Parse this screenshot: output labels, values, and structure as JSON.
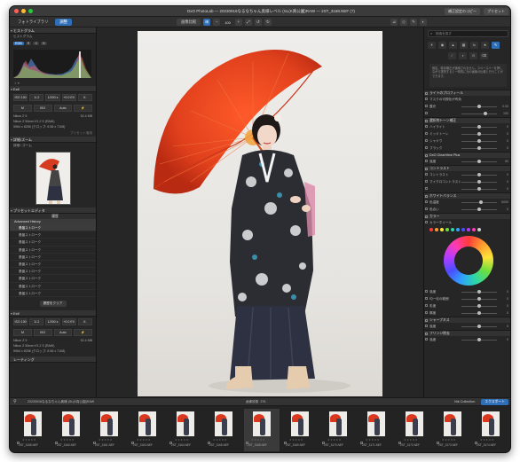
{
  "window": {
    "title": "DxO PhotoLab — 20230916なるなちゃん奥様レベル (SL(K真公園)RAW — 2ST_3168.NEF (?)",
    "right_buttons": [
      "補正設定のコピー",
      "プリセット"
    ]
  },
  "toolbar": {
    "tabs": [
      "フォトライブラリ",
      "調整"
    ],
    "tools": [
      "画像比較",
      "100%"
    ],
    "zoom": "100"
  },
  "left_panel": {
    "histogram": {
      "header": "ヒストグラム",
      "label": "ヒストグラム",
      "channels": [
        "RGB",
        "R",
        "G",
        "B"
      ]
    },
    "exif": {
      "header": "Exif",
      "row": [
        "ISO 100",
        "1/-2",
        "1/200 s",
        "+0.0 EV",
        "f/-"
      ],
      "modes": [
        "M",
        "ISO",
        "Auto"
      ],
      "lines": [
        {
          "left": "Nikon Z 9",
          "right": "52.4 MB"
        },
        {
          "left": "Nikon Z 50mm f/1.2 S (RAW)",
          "right": ""
        },
        {
          "left": "5964 x 8256 (クロップ: 8 56 x 7108)",
          "right": ""
        }
      ],
      "footer": "プリセット適用"
    },
    "loupe": {
      "header": "詳細/ズーム",
      "label": "詳細 / ズーム"
    },
    "history": {
      "header": "プリセットエディタ",
      "sub": "履歴",
      "title": "Advanced History",
      "items": [
        "基盤ストローク",
        "基盤ストローク",
        "基盤ストローク",
        "基盤ストローク",
        "基盤ストローク",
        "基盤ストローク",
        "基盤ストローク",
        "基盤ストローク",
        "基盤ストローク",
        "基盤ストローク"
      ],
      "clear_button": "履歴をクリア"
    },
    "exif2": {
      "header": "Exif",
      "row": [
        "ISO 100",
        "1/-2",
        "1/200 s",
        "+0.0 EV",
        "f/-"
      ],
      "modes": [
        "M",
        "ISO",
        "Auto"
      ],
      "lines": [
        {
          "left": "Nikon Z 9",
          "right": "52.4 MB"
        },
        {
          "left": "Nikon Z 50mm f/1.2 S (RAW)",
          "right": ""
        },
        {
          "left": "5964 x 8256 (クロップ: 8 56 x 7108)",
          "right": ""
        }
      ]
    },
    "rating_header": "レーティング"
  },
  "right_panel": {
    "search_placeholder": "検索を探す",
    "info": "既定。既存補正が適用されません。スペースバーを押しながら選択すると一時的に元の画像の比較と行うことができます。",
    "rows": [
      {
        "type": "hdr",
        "label": "ライトのプロフィール"
      },
      {
        "type": "row",
        "label": "マスクの可視化が有効",
        "val": ""
      },
      {
        "type": "row",
        "label": "露光",
        "val": "0.00",
        "knob": 0.5
      },
      {
        "type": "row",
        "label": "",
        "val": "100",
        "knob": 0.7
      },
      {
        "type": "hdr",
        "label": "選択的トーン補正"
      },
      {
        "type": "row",
        "label": "ハイライト",
        "val": "0",
        "knob": 0.5
      },
      {
        "type": "row",
        "label": "ミッドトーン",
        "val": "0",
        "knob": 0.5
      },
      {
        "type": "row",
        "label": "シャドウ",
        "val": "0",
        "knob": 0.5
      },
      {
        "type": "row",
        "label": "ブラック",
        "val": "0",
        "knob": 0.5
      },
      {
        "type": "hdr",
        "label": "DxO ClearView Plus"
      },
      {
        "type": "row",
        "label": "強度",
        "val": "50",
        "knob": 0.5
      },
      {
        "type": "hdr",
        "label": "コントラスト"
      },
      {
        "type": "row",
        "label": "コントラスト",
        "val": "0",
        "knob": 0.5
      },
      {
        "type": "row",
        "label": "マイクロコントラスト",
        "val": "0",
        "knob": 0.5
      },
      {
        "type": "row",
        "label": "",
        "val": "0",
        "knob": 0.5
      },
      {
        "type": "hdr",
        "label": "ホワイトバランス"
      },
      {
        "type": "row",
        "label": "色温度",
        "val": "5000",
        "knob": 0.55
      },
      {
        "type": "row",
        "label": "色合い",
        "val": "0",
        "knob": 0.5
      },
      {
        "type": "hdr",
        "label": "カラー"
      },
      {
        "type": "row",
        "label": "カラーホイール",
        "val": "",
        "knob": null
      }
    ],
    "lower_rows": [
      {
        "type": "row",
        "label": "強度",
        "val": "0",
        "knob": 0.5
      },
      {
        "type": "row",
        "label": "均一化の範囲",
        "val": "0",
        "knob": 0.5
      },
      {
        "type": "row",
        "label": "彩度",
        "val": "0",
        "knob": 0.5
      },
      {
        "type": "row",
        "label": "輝度",
        "val": "0",
        "knob": 0.5
      },
      {
        "type": "hdr",
        "label": "シャープネス"
      },
      {
        "type": "row",
        "label": "強度",
        "val": "0",
        "knob": 0.5
      },
      {
        "type": "hdr",
        "label": "フリンジ除去"
      },
      {
        "type": "row",
        "label": "強度",
        "val": "0",
        "knob": 0.5
      }
    ],
    "swatch_colors": [
      "#ff3b3b",
      "#ff9a2e",
      "#ffe23a",
      "#6ede3c",
      "#2ed6a8",
      "#2ea3ff",
      "#4c4cff",
      "#b43cff",
      "#ff3bb0",
      "#cccccc"
    ]
  },
  "filmstrip": {
    "path": "20230916なるなちゃん奥様 (SL(K真公園)RAW",
    "mid_label": "画像枚数",
    "mid_count": "376",
    "tabs": [
      "Nik Collection",
      "エクスポート"
    ],
    "thumbs": [
      {
        "name": "2ST_3158.NEF",
        "selected": false
      },
      {
        "name": "2ST_3160.NEF",
        "selected": false
      },
      {
        "name": "2ST_3161.NEF",
        "selected": false
      },
      {
        "name": "2ST_3163.NEF",
        "selected": false
      },
      {
        "name": "2ST_3164.NEF",
        "selected": false
      },
      {
        "name": "2ST_3165.NEF",
        "selected": false
      },
      {
        "name": "2ST_3168.NEF",
        "selected": true
      },
      {
        "name": "2ST_3169.NEF",
        "selected": false
      },
      {
        "name": "2ST_3170.NEF",
        "selected": false
      },
      {
        "name": "2ST_3171.NEF",
        "selected": false
      },
      {
        "name": "2ST_3172.NEF",
        "selected": false
      },
      {
        "name": "2ST_3173.NEF",
        "selected": false
      },
      {
        "name": "2ST_3174.NEF",
        "selected": false
      }
    ]
  }
}
